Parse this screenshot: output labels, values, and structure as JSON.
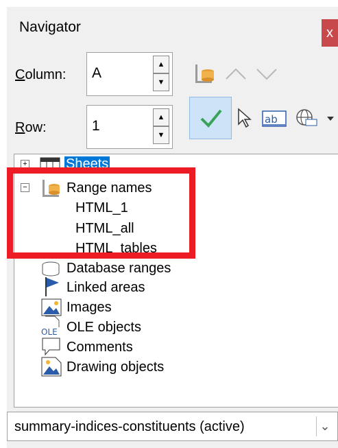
{
  "window": {
    "title": "Navigator",
    "close_glyph": "x"
  },
  "fields": {
    "column_label_u": "C",
    "column_label_rest": "olumn:",
    "column_value": "A",
    "row_label_u": "R",
    "row_label_rest": "ow:",
    "row_value": "1",
    "spin_up": "▲",
    "spin_down": "▼"
  },
  "tree": {
    "collapsed_glyph": "+",
    "expanded_glyph": "−",
    "sheets": "Sheets",
    "range_names": "Range names",
    "range_children": [
      "HTML_1",
      "HTML_all",
      "HTML_tables"
    ],
    "items": [
      "Database ranges",
      "Linked areas",
      "Images",
      "OLE objects",
      "Comments",
      "Drawing objects"
    ],
    "ole_icon_text": "OLE"
  },
  "document_select": {
    "value": "summary-indices-constituents (active)",
    "arrow": "⌄"
  },
  "colors": {
    "highlight": "#ed1c24",
    "selection": "#0078d7",
    "check": "#3aa35a"
  }
}
